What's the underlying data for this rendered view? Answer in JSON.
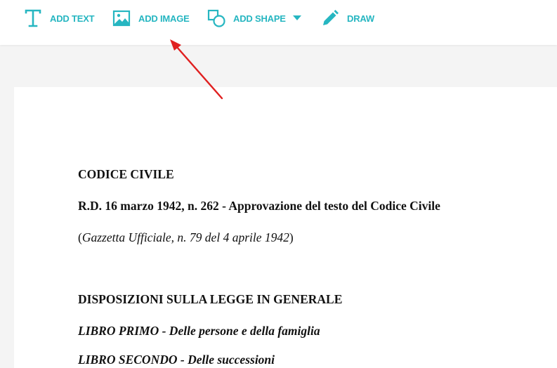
{
  "toolbar": {
    "add_text": "ADD TEXT",
    "add_image": "ADD IMAGE",
    "add_shape": "ADD SHAPE",
    "draw": "DRAW",
    "accent_color": "#26b6c1",
    "icons": [
      "text-icon",
      "image-icon",
      "shape-icon",
      "chevron-down-icon",
      "pencil-icon"
    ]
  },
  "annotation": {
    "color": "#e02020",
    "icon": "red-arrow"
  },
  "document": {
    "line1": "CODICE CIVILE",
    "line2": "R.D. 16 marzo 1942, n. 262 - Approvazione del testo del Codice Civile",
    "line3_open": "(",
    "line3_italic": "Gazzetta Ufficiale, n. 79 del 4 aprile 1942",
    "line3_close": ")",
    "line4": "DISPOSIZIONI SULLA LEGGE IN GENERALE",
    "line5_italic": "LIBRO PRIMO",
    "line5_rest": " - Delle persone e della famiglia",
    "line6_italic": "LIBRO SECONDO",
    "line6_rest": " - Delle successioni"
  }
}
